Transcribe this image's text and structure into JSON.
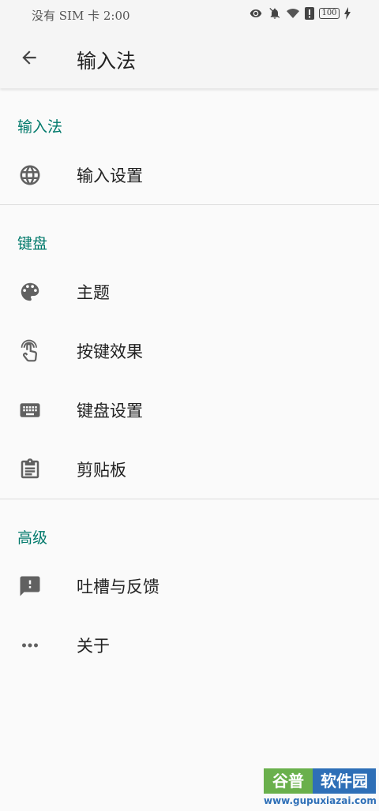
{
  "status_bar": {
    "text": "没有 SIM 卡 2:00",
    "battery": "100"
  },
  "app_bar": {
    "title": "输入法"
  },
  "sections": [
    {
      "header": "输入法",
      "items": [
        {
          "label": "输入设置",
          "icon": "globe-icon"
        }
      ]
    },
    {
      "header": "键盘",
      "items": [
        {
          "label": "主题",
          "icon": "palette-icon"
        },
        {
          "label": "按键效果",
          "icon": "touch-icon"
        },
        {
          "label": "键盘设置",
          "icon": "keyboard-icon"
        },
        {
          "label": "剪贴板",
          "icon": "clipboard-icon"
        }
      ]
    },
    {
      "header": "高级",
      "items": [
        {
          "label": "吐槽与反馈",
          "icon": "feedback-icon"
        },
        {
          "label": "关于",
          "icon": "more-horiz-icon"
        }
      ]
    }
  ],
  "watermark": {
    "left": "谷普",
    "right": "软件园",
    "url": "www.gupuxiazai.com"
  },
  "colors": {
    "accent": "#00796b",
    "background": "#fafafa",
    "icon": "#616161"
  }
}
